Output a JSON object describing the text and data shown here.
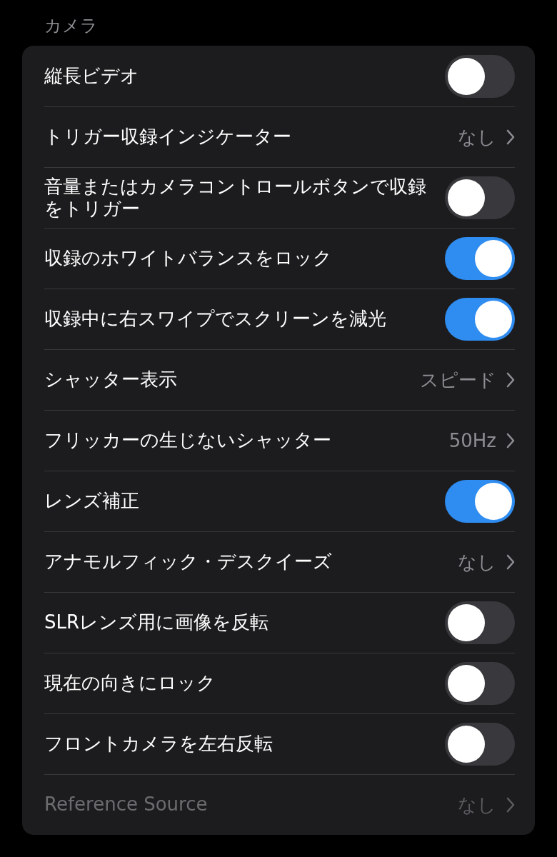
{
  "section": {
    "title": "カメラ"
  },
  "rows": [
    {
      "kind": "toggle",
      "label": "縦長ビデオ",
      "on": false,
      "disabled": false
    },
    {
      "kind": "value",
      "label": "トリガー収録インジケーター",
      "value": "なし",
      "disabled": false
    },
    {
      "kind": "toggle",
      "label": "音量またはカメラコントロールボタンで収録をトリガー",
      "on": false,
      "disabled": false
    },
    {
      "kind": "toggle",
      "label": "収録のホワイトバランスをロック",
      "on": true,
      "disabled": false
    },
    {
      "kind": "toggle",
      "label": "収録中に右スワイプでスクリーンを減光",
      "on": true,
      "disabled": false
    },
    {
      "kind": "value",
      "label": "シャッター表示",
      "value": "スピード",
      "disabled": false
    },
    {
      "kind": "value",
      "label": "フリッカーの生じないシャッター",
      "value": "50Hz",
      "disabled": false
    },
    {
      "kind": "toggle",
      "label": "レンズ補正",
      "on": true,
      "disabled": false
    },
    {
      "kind": "value",
      "label": "アナモルフィック・デスクイーズ",
      "value": "なし",
      "disabled": false
    },
    {
      "kind": "toggle",
      "label": "SLRレンズ用に画像を反転",
      "on": false,
      "disabled": false
    },
    {
      "kind": "toggle",
      "label": "現在の向きにロック",
      "on": false,
      "disabled": false
    },
    {
      "kind": "toggle",
      "label": "フロントカメラを左右反転",
      "on": false,
      "disabled": false
    },
    {
      "kind": "value",
      "label": "Reference Source",
      "value": "なし",
      "disabled": true
    }
  ]
}
